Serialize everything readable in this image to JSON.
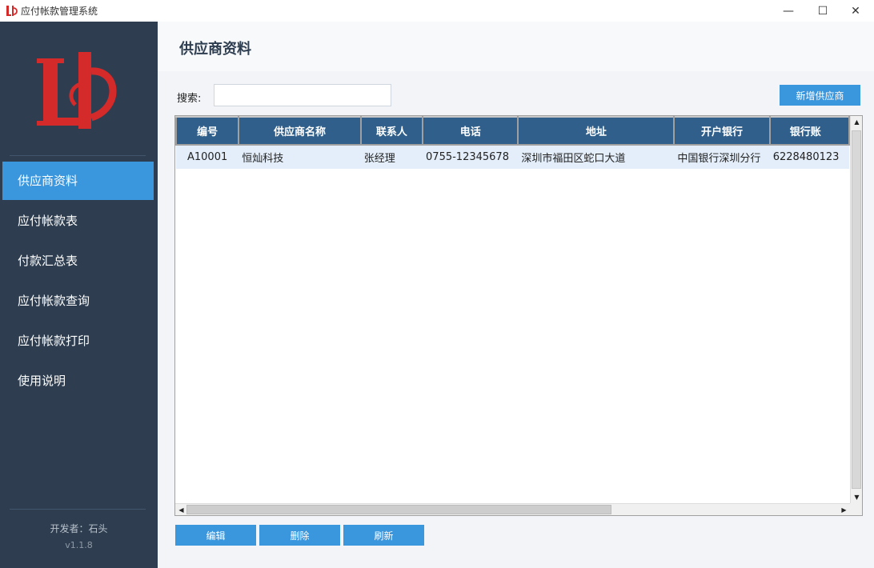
{
  "window": {
    "title": "应付帐款管理系统",
    "minimize": "—",
    "maximize": "☐",
    "close": "✕"
  },
  "sidebar": {
    "items": [
      {
        "label": "供应商资料",
        "active": true
      },
      {
        "label": "应付帐款表",
        "active": false
      },
      {
        "label": "付款汇总表",
        "active": false
      },
      {
        "label": "应付帐款查询",
        "active": false
      },
      {
        "label": "应付帐款打印",
        "active": false
      },
      {
        "label": "使用说明",
        "active": false
      }
    ],
    "developer": "开发者：石头",
    "version": "v1.1.8"
  },
  "main": {
    "title": "供应商资料",
    "search_label": "搜索:",
    "search_value": "",
    "add_button": "新增供应商",
    "table": {
      "columns": [
        "编号",
        "供应商名称",
        "联系人",
        "电话",
        "地址",
        "开户银行",
        "银行账"
      ],
      "rows": [
        [
          "A10001",
          "恒灿科技",
          "张经理",
          "0755-12345678",
          "深圳市福田区蛇口大道",
          "中国银行深圳分行",
          "6228480123"
        ]
      ]
    },
    "buttons": {
      "edit": "编辑",
      "delete": "删除",
      "refresh": "刷新"
    }
  },
  "colors": {
    "sidebar_bg": "#2e3e50",
    "accent": "#3a96dd",
    "header_bg": "#2f5f8a",
    "row_bg": "#e3eefa",
    "logo_red": "#d42a2a"
  }
}
